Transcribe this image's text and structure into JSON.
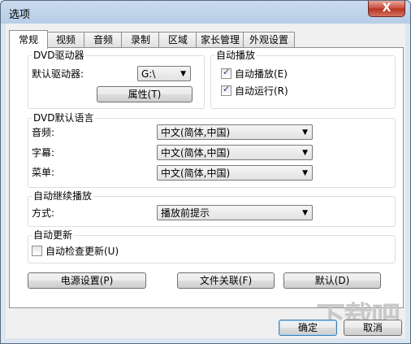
{
  "window": {
    "title": "选项",
    "close_label": "X"
  },
  "tabs": [
    "常规",
    "视频",
    "音频",
    "录制",
    "区域",
    "家长管理",
    "外观设置"
  ],
  "dvd_drive": {
    "group_label": "DVD驱动器",
    "default_label": "默认驱动器:",
    "drive_value": "G:\\",
    "properties_button": "属性(T)"
  },
  "autoplay": {
    "group_label": "自动播放",
    "autoplay_label": "自动播放(E)",
    "autoplay_checked": true,
    "autorun_label": "自动运行(R)",
    "autorun_checked": true
  },
  "language": {
    "group_label": "DVD默认语言",
    "audio_label": "音频:",
    "audio_value": "中文(简体,中国)",
    "subtitle_label": "字幕:",
    "subtitle_value": "中文(简体,中国)",
    "menu_label": "菜单:",
    "menu_value": "中文(简体,中国)"
  },
  "resume": {
    "group_label": "自动继续播放",
    "mode_label": "方式:",
    "mode_value": "播放前提示"
  },
  "update": {
    "group_label": "自动更新",
    "check_label": "自动检查更新(U)",
    "check_checked": false
  },
  "buttons": {
    "power": "电源设置(P)",
    "assoc": "文件关联(F)",
    "default": "默认(D)",
    "ok": "确定",
    "cancel": "取消"
  },
  "watermark": "下载吧"
}
